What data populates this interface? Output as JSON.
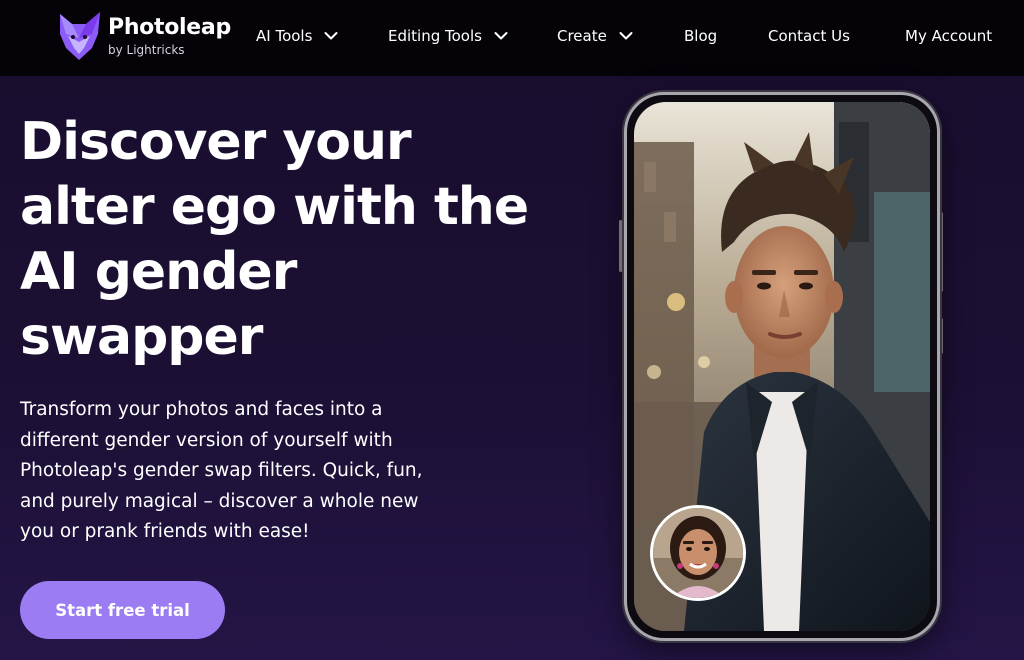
{
  "nav": {
    "brand_name": "Photoleap",
    "brand_sub": "by Lightricks",
    "items": [
      {
        "label": "AI Tools",
        "dropdown": true
      },
      {
        "label": "Editing Tools",
        "dropdown": true
      },
      {
        "label": "Create",
        "dropdown": true
      },
      {
        "label": "Blog",
        "dropdown": false
      },
      {
        "label": "Contact Us",
        "dropdown": false
      },
      {
        "label": "My Account",
        "dropdown": false
      }
    ]
  },
  "hero": {
    "title_lines": [
      "Discover your",
      "alter ego with the",
      "AI gender",
      "swapper"
    ],
    "description_lines": [
      "Transform your photos and faces into a",
      "different gender version of yourself with",
      "Photoleap's gender swap filters. Quick, fun,",
      "and purely magical – discover a whole new",
      "you or prank friends with ease!"
    ],
    "cta_label": "Start free trial"
  },
  "colors": {
    "accent": "#9b7cf3",
    "nav_bg": "#050308",
    "page_bg": "#1b0f33",
    "logo": "#8b5cf6"
  },
  "icons": {
    "brand": "fox-logo-icon",
    "dropdown": "chevron-down-icon"
  }
}
